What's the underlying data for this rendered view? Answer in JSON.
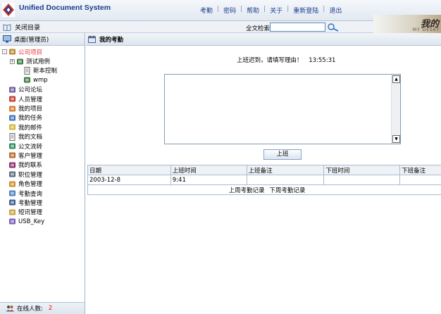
{
  "app": {
    "title": "Unified Document System"
  },
  "top_nav": [
    "考勤",
    "密码",
    "帮助",
    "关于",
    "重新登陆",
    "退出"
  ],
  "banner": {
    "text": "我的",
    "sub": "MY DESKT"
  },
  "toolbar": {
    "close_dir": "关闭目录",
    "search_label": "全文检索",
    "search_value": ""
  },
  "sidebar": {
    "title": "桌面(管理员)",
    "items": [
      {
        "label": "公司项目",
        "icon": "folder-books-icon",
        "level": 0,
        "active": true,
        "expander": "-"
      },
      {
        "label": "测试用例",
        "icon": "books-icon",
        "level": 1,
        "expander": "+"
      },
      {
        "label": "新本控制",
        "icon": "document-icon",
        "level": 2
      },
      {
        "label": "wmp",
        "icon": "books-icon",
        "level": 2
      },
      {
        "label": "公司论坛",
        "icon": "forum-icon",
        "level": 0
      },
      {
        "label": "人员管理",
        "icon": "person-icon",
        "level": 0
      },
      {
        "label": "我的项目",
        "icon": "project-icon",
        "level": 0
      },
      {
        "label": "我的任务",
        "icon": "task-icon",
        "level": 0
      },
      {
        "label": "我的邮件",
        "icon": "mail-icon",
        "level": 0
      },
      {
        "label": "我的文档",
        "icon": "document-icon",
        "level": 0
      },
      {
        "label": "公文流转",
        "icon": "workflow-icon",
        "level": 0
      },
      {
        "label": "客户管理",
        "icon": "customers-icon",
        "level": 0
      },
      {
        "label": "我的联系",
        "icon": "contacts-icon",
        "level": 0
      },
      {
        "label": "职位管理",
        "icon": "position-icon",
        "level": 0
      },
      {
        "label": "角色管理",
        "icon": "roles-icon",
        "level": 0
      },
      {
        "label": "考勤查询",
        "icon": "search-icon",
        "level": 0
      },
      {
        "label": "考勤管理",
        "icon": "clock-icon",
        "level": 0
      },
      {
        "label": "短讯管理",
        "icon": "message-icon",
        "level": 0
      },
      {
        "label": "USB_Key",
        "icon": "usb-key-icon",
        "level": 0
      }
    ],
    "online_label": "在线人数:",
    "online_count": "2"
  },
  "main": {
    "title": "我的考勤",
    "late_message": "上班迟到，请填写理由！",
    "late_time": "13:55:31",
    "reason_value": "",
    "submit_label": "上班",
    "table": {
      "headers": [
        "日期",
        "上班时间",
        "上班备注",
        "下班时间",
        "下班备注"
      ],
      "rows": [
        [
          "2003-12-8",
          "9:41",
          "",
          "",
          ""
        ]
      ],
      "prev_week": "上周考勤记录",
      "next_week": "下周考勤记录"
    }
  },
  "colors": {
    "accent": "#1b3d8e",
    "active": "#e33",
    "online_count": "#e11"
  }
}
